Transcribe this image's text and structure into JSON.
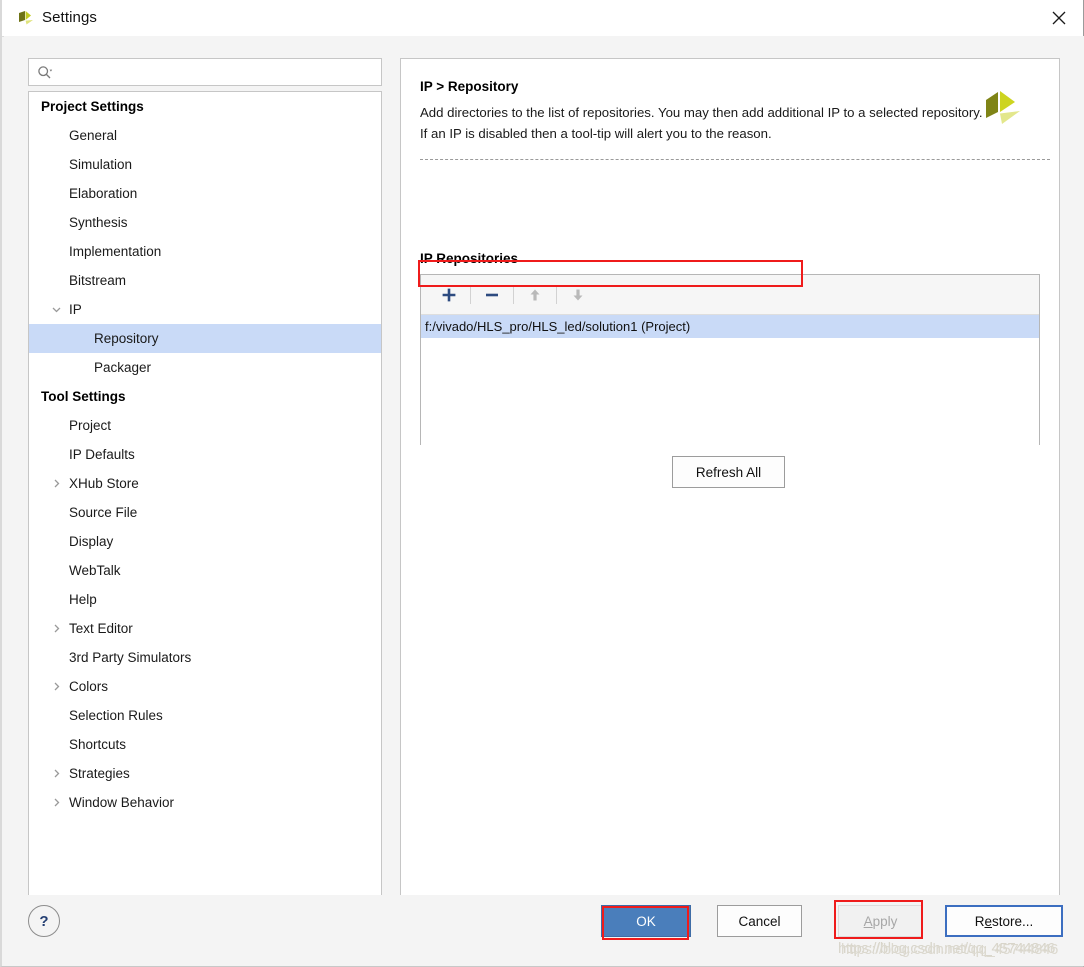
{
  "window": {
    "title": "Settings",
    "logo_icon": "xilinx-logo-icon",
    "close_icon": "close-icon"
  },
  "search": {
    "icon": "search-icon",
    "value": "",
    "placeholder": ""
  },
  "sidebar": {
    "groups": [
      {
        "label": "Project Settings",
        "items": [
          {
            "label": "General",
            "level": 1,
            "twisty": "",
            "selected": false
          },
          {
            "label": "Simulation",
            "level": 1,
            "twisty": "",
            "selected": false
          },
          {
            "label": "Elaboration",
            "level": 1,
            "twisty": "",
            "selected": false
          },
          {
            "label": "Synthesis",
            "level": 1,
            "twisty": "",
            "selected": false
          },
          {
            "label": "Implementation",
            "level": 1,
            "twisty": "",
            "selected": false
          },
          {
            "label": "Bitstream",
            "level": 1,
            "twisty": "",
            "selected": false
          },
          {
            "label": "IP",
            "level": 1,
            "twisty": "down",
            "selected": false
          },
          {
            "label": "Repository",
            "level": 2,
            "twisty": "",
            "selected": true
          },
          {
            "label": "Packager",
            "level": 2,
            "twisty": "",
            "selected": false
          }
        ]
      },
      {
        "label": "Tool Settings",
        "items": [
          {
            "label": "Project",
            "level": 1,
            "twisty": "",
            "selected": false
          },
          {
            "label": "IP Defaults",
            "level": 1,
            "twisty": "",
            "selected": false
          },
          {
            "label": "XHub Store",
            "level": 1,
            "twisty": "right",
            "selected": false
          },
          {
            "label": "Source File",
            "level": 1,
            "twisty": "",
            "selected": false
          },
          {
            "label": "Display",
            "level": 1,
            "twisty": "",
            "selected": false
          },
          {
            "label": "WebTalk",
            "level": 1,
            "twisty": "",
            "selected": false
          },
          {
            "label": "Help",
            "level": 1,
            "twisty": "",
            "selected": false
          },
          {
            "label": "Text Editor",
            "level": 1,
            "twisty": "right",
            "selected": false
          },
          {
            "label": "3rd Party Simulators",
            "level": 1,
            "twisty": "",
            "selected": false
          },
          {
            "label": "Colors",
            "level": 1,
            "twisty": "right",
            "selected": false
          },
          {
            "label": "Selection Rules",
            "level": 1,
            "twisty": "",
            "selected": false
          },
          {
            "label": "Shortcuts",
            "level": 1,
            "twisty": "",
            "selected": false
          },
          {
            "label": "Strategies",
            "level": 1,
            "twisty": "right",
            "selected": false
          },
          {
            "label": "Window Behavior",
            "level": 1,
            "twisty": "right",
            "selected": false
          }
        ]
      }
    ]
  },
  "page": {
    "title": "IP > Repository",
    "description": "Add directories to the list of repositories. You may then add additional IP to a selected repository. If an IP is disabled then a tool-tip will alert you to the reason.",
    "logo_icon": "xilinx-logo-icon",
    "repositories_label": "IP Repositories",
    "toolbar": [
      {
        "name": "add-repository-button",
        "icon": "plus-icon",
        "enabled": true
      },
      {
        "name": "remove-repository-button",
        "icon": "minus-icon",
        "enabled": true
      },
      {
        "name": "move-up-button",
        "icon": "arrow-up-icon",
        "enabled": false
      },
      {
        "name": "move-down-button",
        "icon": "arrow-down-icon",
        "enabled": false
      }
    ],
    "repositories": [
      {
        "path": "f:/vivado/HLS_pro/HLS_led/solution1 (Project)",
        "selected": true
      }
    ],
    "refresh_all_label": "Refresh All"
  },
  "footer": {
    "help_label": "?",
    "ok_label": "OK",
    "cancel_label": "Cancel",
    "apply_label": "Apply",
    "restore_label": "Restore..."
  },
  "watermark": {
    "text": "https://blog.csdn.net/qq_45744846"
  },
  "colors": {
    "selection_blue": "#c9daf7",
    "primary_button": "#4a7ebb",
    "focus_border": "#3c6ec0",
    "annotation_red": "#ef1b1b",
    "toolbar_icon": "#2d4b80",
    "logo_olive": "#b5bd1f"
  }
}
